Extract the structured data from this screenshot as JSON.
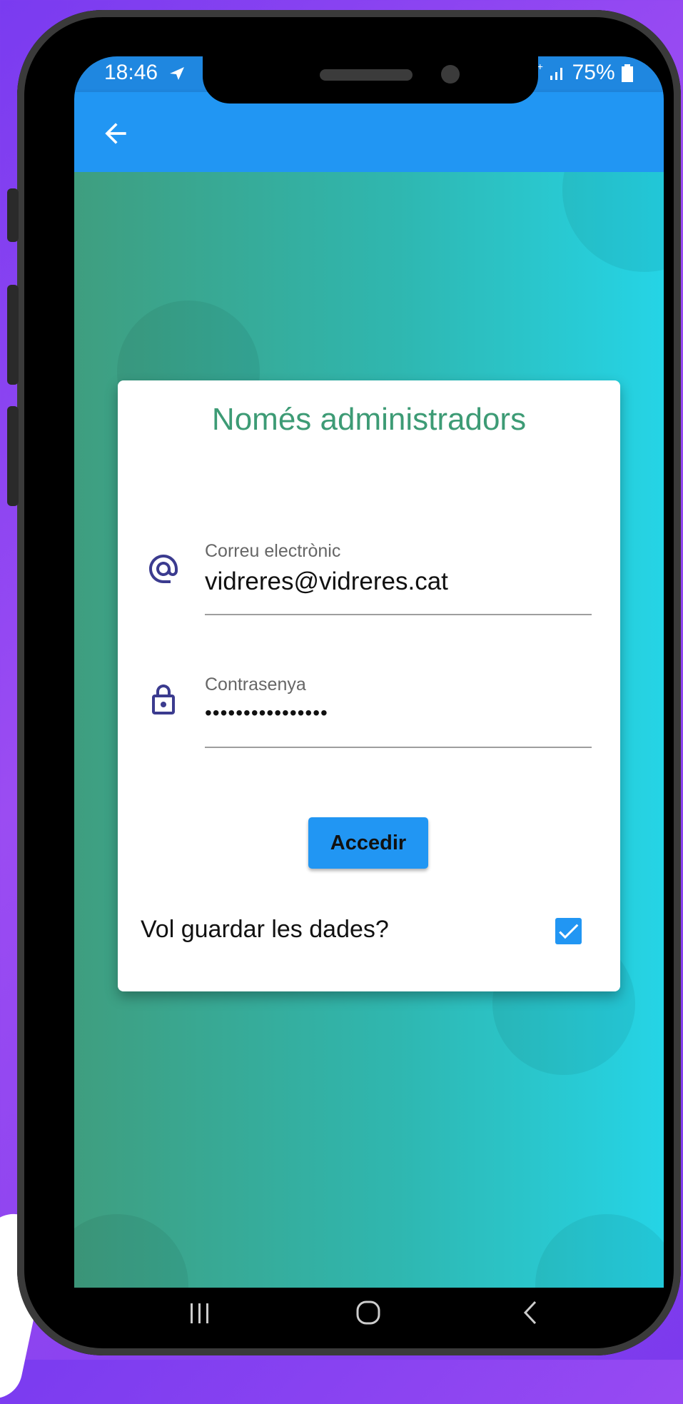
{
  "status_bar": {
    "time": "18:46",
    "telegram_icon": "send-icon",
    "network": "4G+",
    "battery": "75%"
  },
  "app_bar": {
    "back_icon": "arrow-back-icon"
  },
  "card": {
    "title": "Només administradors",
    "email": {
      "label": "Correu electrònic",
      "value": "vidreres@vidreres.cat",
      "icon": "at-sign-icon"
    },
    "password": {
      "label": "Contrasenya",
      "value": "••••••••••••••••",
      "icon": "lock-icon"
    },
    "submit_label": "Accedir",
    "remember": {
      "label": "Vol guardar les dades?",
      "checked": true
    }
  },
  "colors": {
    "primary": "#2196f3",
    "title_green": "#3d9b75",
    "icon_indigo": "#3b3b8f"
  },
  "nav_bar": {
    "icons": [
      "recent-apps-icon",
      "home-icon",
      "back-nav-icon"
    ]
  }
}
